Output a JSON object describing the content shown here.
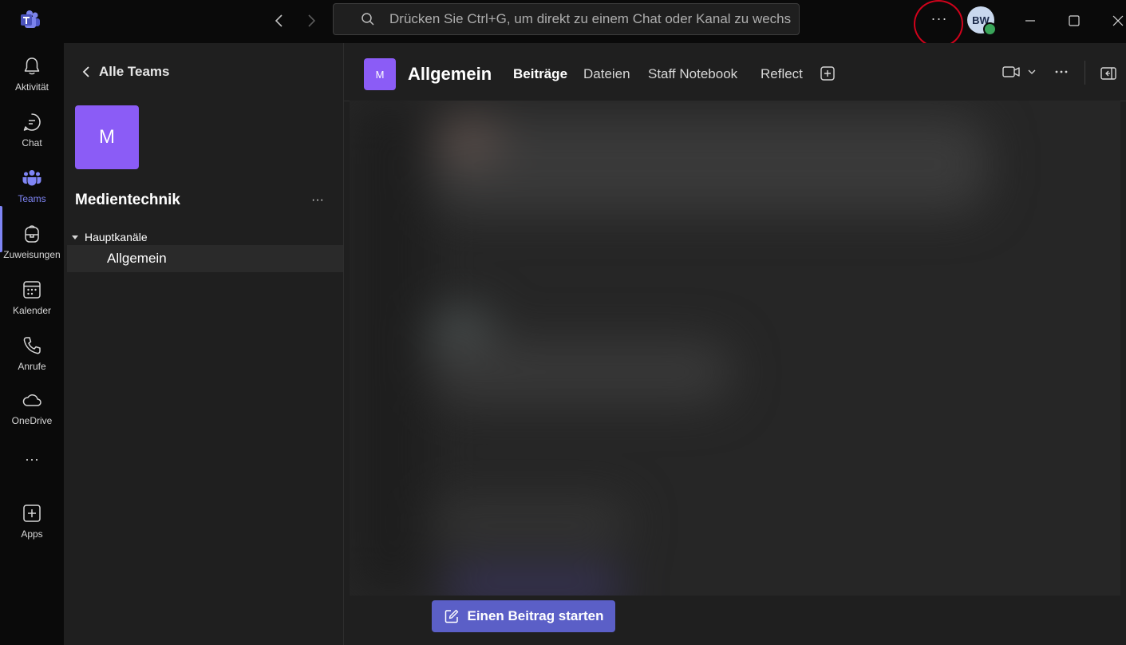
{
  "titlebar": {
    "search_placeholder": "Drücken Sie Ctrl+G, um direkt zu einem Chat oder Kanal zu wechs",
    "user_initials": "BW"
  },
  "rail": {
    "items": [
      {
        "label": "Aktivität",
        "icon": "bell-icon"
      },
      {
        "label": "Chat",
        "icon": "chat-icon"
      },
      {
        "label": "Teams",
        "icon": "teams-icon"
      },
      {
        "label": "Zuweisungen",
        "icon": "backpack-icon"
      },
      {
        "label": "Kalender",
        "icon": "calendar-icon"
      },
      {
        "label": "Anrufe",
        "icon": "phone-icon"
      },
      {
        "label": "OneDrive",
        "icon": "cloud-icon"
      },
      {
        "label": "Apps",
        "icon": "plus-square-icon"
      }
    ],
    "more_label": "···",
    "active_item": "Teams"
  },
  "sidebar": {
    "back_label": "Alle Teams",
    "team_initial": "M",
    "team_name": "Medientechnik",
    "more_label": "···",
    "section_label": "Hauptkanäle",
    "channels": [
      {
        "label": "Allgemein"
      }
    ]
  },
  "main": {
    "channel_initial": "M",
    "channel_title": "Allgemein",
    "tabs": [
      {
        "label": "Beiträge",
        "active": true
      },
      {
        "label": "Dateien",
        "active": false
      },
      {
        "label": "Staff Notebook",
        "active": false
      },
      {
        "label": "Reflect",
        "active": false
      }
    ],
    "compose_label": "Einen Beitrag starten"
  },
  "top_more_label": "···",
  "colors": {
    "accent": "#7f85f5",
    "team_tile": "#8b5cf6",
    "compose_button": "#5b5fc7",
    "highlight_circle": "#d0021b",
    "presence": "#3aa55a"
  }
}
